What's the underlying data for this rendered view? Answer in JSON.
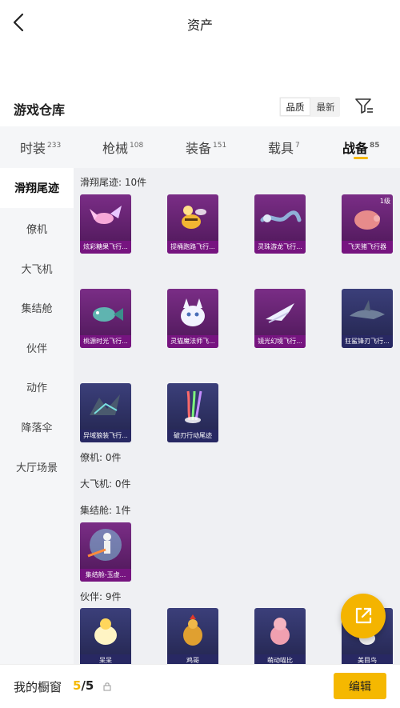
{
  "header": {
    "title": "资产"
  },
  "section": {
    "title": "游戏仓库"
  },
  "sort": {
    "options": [
      "品质",
      "最新"
    ]
  },
  "tabs": [
    {
      "label": "时装",
      "count": "233"
    },
    {
      "label": "枪械",
      "count": "108"
    },
    {
      "label": "装备",
      "count": "151"
    },
    {
      "label": "载具",
      "count": "7"
    },
    {
      "label": "战备",
      "count": "85"
    }
  ],
  "sidebar": {
    "items": [
      "滑翔尾迹",
      "僚机",
      "大飞机",
      "集结舱",
      "伙伴",
      "动作",
      "降落伞",
      "大厅场景"
    ]
  },
  "groups": {
    "glide_trail": {
      "label": "滑翔尾迹: 10件",
      "items": [
        {
          "name": "炫彩糖果飞行...",
          "level": ""
        },
        {
          "name": "提桶跑路飞行...",
          "level": ""
        },
        {
          "name": "灵珠游龙飞行...",
          "level": ""
        },
        {
          "name": "飞天猪飞行器",
          "level": "1级"
        },
        {
          "name": "桃源时光飞行...",
          "level": ""
        },
        {
          "name": "灵猫魔法师飞...",
          "level": ""
        },
        {
          "name": "镜光幻境飞行...",
          "level": ""
        },
        {
          "name": "狂鲨锋刃飞行...",
          "level": ""
        },
        {
          "name": "异域狼装飞行...",
          "level": ""
        },
        {
          "name": "破刃行动尾迹",
          "level": ""
        }
      ]
    },
    "wingman": {
      "label": "僚机: 0件"
    },
    "big_plane": {
      "label": "大飞机: 0件"
    },
    "pod": {
      "label": "集结舱: 1件",
      "items": [
        {
          "name": "集结舱-玉虚..."
        }
      ]
    },
    "companion": {
      "label": "伙伴: 9件",
      "items": [
        {
          "name": "呆呆"
        },
        {
          "name": "鸡哥"
        },
        {
          "name": "萌动喵比"
        },
        {
          "name": "美目鸟"
        }
      ]
    }
  },
  "bottom": {
    "label": "我的橱窗",
    "current": "5",
    "separator": "/",
    "total": "5",
    "edit_label": "编辑"
  },
  "colors": {
    "accent": "#f5b800",
    "card_purple": "#7a2d86",
    "card_blue": "#3b3f7a"
  }
}
